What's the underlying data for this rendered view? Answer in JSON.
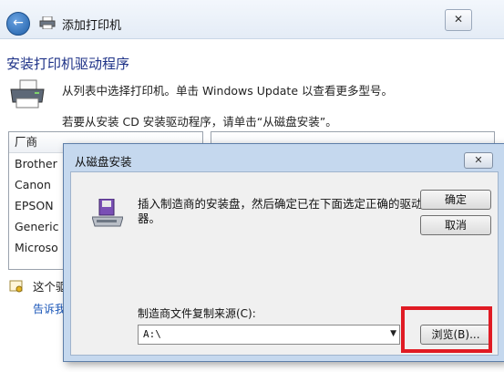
{
  "wizard": {
    "window_title": "添加打印机",
    "heading": "安装打印机驱动程序",
    "instruction_1": "从列表中选择打印机。单击 Windows Update 以查看更多型号。",
    "instruction_2": "若要从安装 CD 安装驱动程序，请单击“从磁盘安装”。",
    "manufacturer_list": {
      "header": "厂商",
      "items": [
        "Brother",
        "Canon",
        "EPSON",
        "Generic",
        "Microso"
      ]
    },
    "info_line_1": "这个驱",
    "info_line_2": "告诉我"
  },
  "dialog": {
    "title": "从磁盘安装",
    "close_label": "✕",
    "message": "插入制造商的安装盘，然后确定已在下面选定正确的驱动器。",
    "ok_label": "确定",
    "cancel_label": "取消",
    "source_label": "制造商文件复制来源(C):",
    "source_value": "A:\\",
    "browse_label": "浏览(B)...",
    "highlight_color": "#e01b24"
  },
  "icons": {
    "back": "back-arrow-icon",
    "printer": "printer-icon",
    "disk": "disk-drive-icon",
    "certificate": "certificate-icon"
  }
}
